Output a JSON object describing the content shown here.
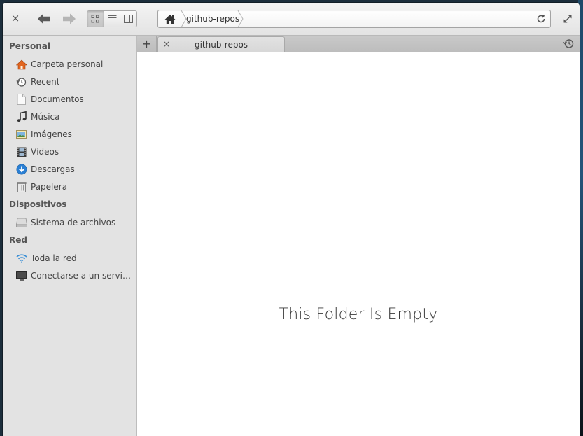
{
  "toolbar": {
    "close_glyph": "×",
    "back_icon": "arrow-left-icon",
    "forward_icon": "arrow-right-icon",
    "views": [
      "icon-view",
      "list-view",
      "column-view"
    ],
    "active_view": "icon-view",
    "path": {
      "home_icon": "home-icon",
      "crumb": "github-repos"
    },
    "reload_icon": "reload-icon",
    "fullscreen_icon": "fullscreen-icon"
  },
  "sidebar": {
    "sections": [
      {
        "heading": "Personal",
        "items": [
          {
            "label": "Carpeta personal",
            "icon": "home-folder-icon"
          },
          {
            "label": "Recent",
            "icon": "recent-clock-icon"
          },
          {
            "label": "Documentos",
            "icon": "document-icon"
          },
          {
            "label": "Música",
            "icon": "music-note-icon"
          },
          {
            "label": "Imágenes",
            "icon": "pictures-icon"
          },
          {
            "label": "Vídeos",
            "icon": "film-icon"
          },
          {
            "label": "Descargas",
            "icon": "download-icon"
          },
          {
            "label": "Papelera",
            "icon": "trash-icon"
          }
        ]
      },
      {
        "heading": "Dispositivos",
        "items": [
          {
            "label": "Sistema de archivos",
            "icon": "drive-icon"
          }
        ]
      },
      {
        "heading": "Red",
        "items": [
          {
            "label": "Toda la red",
            "icon": "wifi-icon"
          },
          {
            "label": "Conectarse a un servid...",
            "icon": "monitor-icon"
          }
        ]
      }
    ]
  },
  "tabbar": {
    "new_tab_glyph": "+",
    "tabs": [
      {
        "label": "github-repos",
        "close_glyph": "×"
      }
    ],
    "history_icon": "history-icon"
  },
  "main": {
    "empty_message": "This Folder Is Empty"
  },
  "colors": {
    "accent_home": "#e05a1a",
    "download_blue": "#2a7fd4",
    "wifi_blue": "#3a8fd6"
  }
}
